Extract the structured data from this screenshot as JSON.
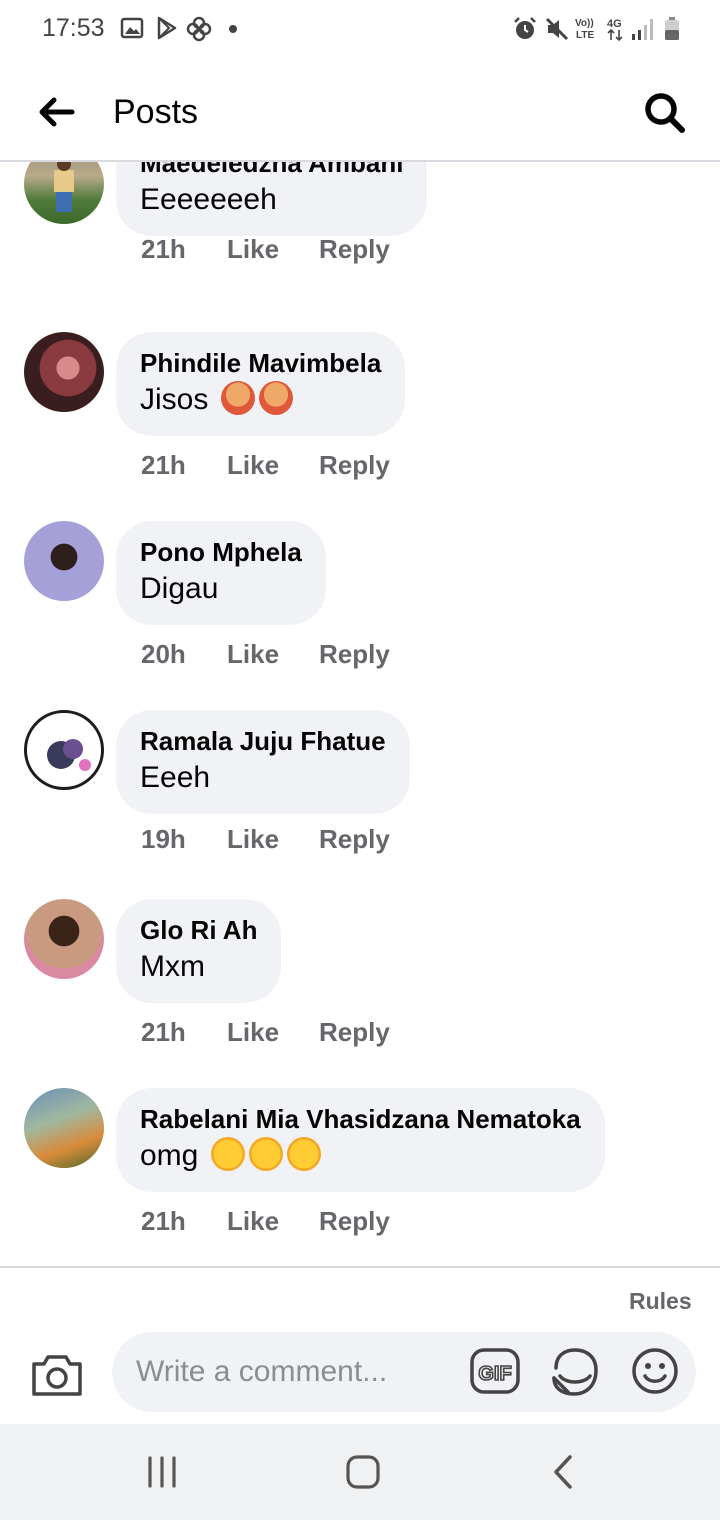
{
  "status_bar": {
    "time": "17:53",
    "left_icons": [
      "image-icon",
      "play-store-icon",
      "pinwheel-icon",
      "dot-icon"
    ],
    "right_icons": [
      "alarm-icon",
      "mute-icon",
      "volte-icon",
      "4g-icon",
      "signal-icon",
      "battery-icon"
    ],
    "volte_label": "Vo)) LTE",
    "network_label": "4G"
  },
  "header": {
    "back_icon": "arrow-left-icon",
    "title": "Posts",
    "search_icon": "search-icon"
  },
  "comments": [
    {
      "author": "Maedeledzha Ambani",
      "text": " Eeeeeeeh",
      "emojis": [],
      "time": "21h",
      "like": "Like",
      "reply": "Reply"
    },
    {
      "author": "Phindile Mavimbela",
      "text": "Jisos",
      "emojis": [
        "person-gesturing-ok",
        "person-gesturing-ok"
      ],
      "time": "21h",
      "like": "Like",
      "reply": "Reply"
    },
    {
      "author": "Pono Mphela",
      "text": "Digau",
      "emojis": [],
      "time": "20h",
      "like": "Like",
      "reply": "Reply"
    },
    {
      "author": "Ramala Juju Fhatue",
      "text": "Eeeh",
      "emojis": [],
      "time": "19h",
      "like": "Like",
      "reply": "Reply"
    },
    {
      "author": "Glo Ri Ah",
      "text": "Mxm",
      "emojis": [],
      "time": "21h",
      "like": "Like",
      "reply": "Reply"
    },
    {
      "author": "Rabelani Mia Vhasidzana Nematoka",
      "text": "omg",
      "emojis": [
        "rolling-on-floor-laughing",
        "rolling-on-floor-laughing",
        "rolling-on-floor-laughing"
      ],
      "time": "21h",
      "like": "Like",
      "reply": "Reply"
    }
  ],
  "composer": {
    "rules_label": "Rules",
    "placeholder": "Write a comment...",
    "camera_icon": "camera-icon",
    "gif_label": "GIF",
    "sticker_icon": "sticker-icon",
    "emoji_icon": "smiley-icon"
  },
  "nav_bar": {
    "icons": [
      "recent-apps-icon",
      "home-icon",
      "back-icon"
    ]
  },
  "colors": {
    "bubble_bg": "#f0f2f5",
    "secondary_text": "#65676b",
    "primary_text": "#050505",
    "divider": "#d8dadf",
    "nav_bar_bg": "#f0f1f3"
  }
}
